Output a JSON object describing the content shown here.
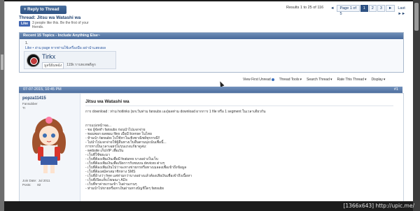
{
  "reply_button": "+ Reply to Thread",
  "thread": {
    "title": "Thread: Jitsu wa Watashi wa",
    "like_button": "Like",
    "like_text": "3 people like this. Be the first of your friends."
  },
  "pagination": {
    "results": "Results 1 to 25 of 116",
    "prev": "◄",
    "page_of": "Page 1 of 5",
    "pages": [
      "1",
      "2",
      "3"
    ],
    "next": "►",
    "last": "Last ►►"
  },
  "recent": {
    "header": "Recent 15 Topics - Include Anything Else~",
    "number": "1.",
    "link": "Like • ล่าม page หากท่านใช้เครื่องมือ อย่านำแสดงผล",
    "topic_title": "Tirkx",
    "topic_user": "มูลนิธิมพฉัง",
    "topic_views": "115k ราบทเหพดีดูก"
  },
  "toolbar": {
    "view_first_unread": "View First Unread",
    "thread_tools": "Thread Tools",
    "search_thread": "Search Thread",
    "rate_thread": "Rate This Thread",
    "display": "Display"
  },
  "post": {
    "date": "07-07-2015, 10:45 PM",
    "number": "#1",
    "username": "popza11415",
    "usertitle": "Fansubber",
    "userrank": "TI",
    "join_label": "Join Date:",
    "join_value": "Jul 2011",
    "posts_label": "Posts:",
    "posts_value": "82",
    "title": "Jitsu wa Watashi wa",
    "lines": [
      "การ download : ท่าม hotlinks (ยกเว้นท่าม fansubs เอง)ผลท่าม download ผากการ 1 file หรือ 1 segment ในเวลาเดียวกัน",
      "การแบ่งหน้าจอ...",
      "- ชอ ผู้จัดทำ fansubs ก่อนนำไปแจกจ่าย",
      "- พอมพอก ผลพอม files เมื่อมี license ในไทย",
      "- ห้ามนำ fansubs ไปใช้หาในเชิงพาณิชย์ทุกกรณี!!",
      "- ไม่นำไปแจกจ่ายให้ผู้อื่นทางเว็บอื่นตามมุ่งเน้นเพื่อนี้...",
      "การหาเป็นเวลาเฉยๆไม่รุนแรงแก้ยาดูล่ม:",
      "- website เก็บVIP เพื่อเงิน",
      "- เว็บที่ใช้ขยะมา",
      "- เว็บที่ต้องเพิ่มเงินเพื่อมี features บางอย่างในเว็บ",
      "- เว็บที่ต้องเพิ่มเงินเพื่อเปิดการรับชมบน devices ต่างๆ",
      "- เว็บที่ต้องเพิ่มเงินไปว่าจะทางข่ายกรหรือทางเมลลงเพื่อเข้าถึงข้อมูล",
      "- เว็บที่ต้องสมัครสมาชิกทาง SMS",
      "- เว็บที่อ้างว่า free แต่ห่ามกว่าบางอย่างแล้วต้องเสียเงินเพื่อเข้าถึงเนื้อหา",
      "- เว็บที่เปิดแท็บโฆษณา ADs",
      "- เว็บที่หาค่ายงานเข้า ในผ่านงานๆ",
      "- ห่ามนำไปขายหรือหาเงินผ่านทางบัญชีใดๆ fansubs"
    ]
  },
  "watermark": "[1366x643] http://upic.me/"
}
